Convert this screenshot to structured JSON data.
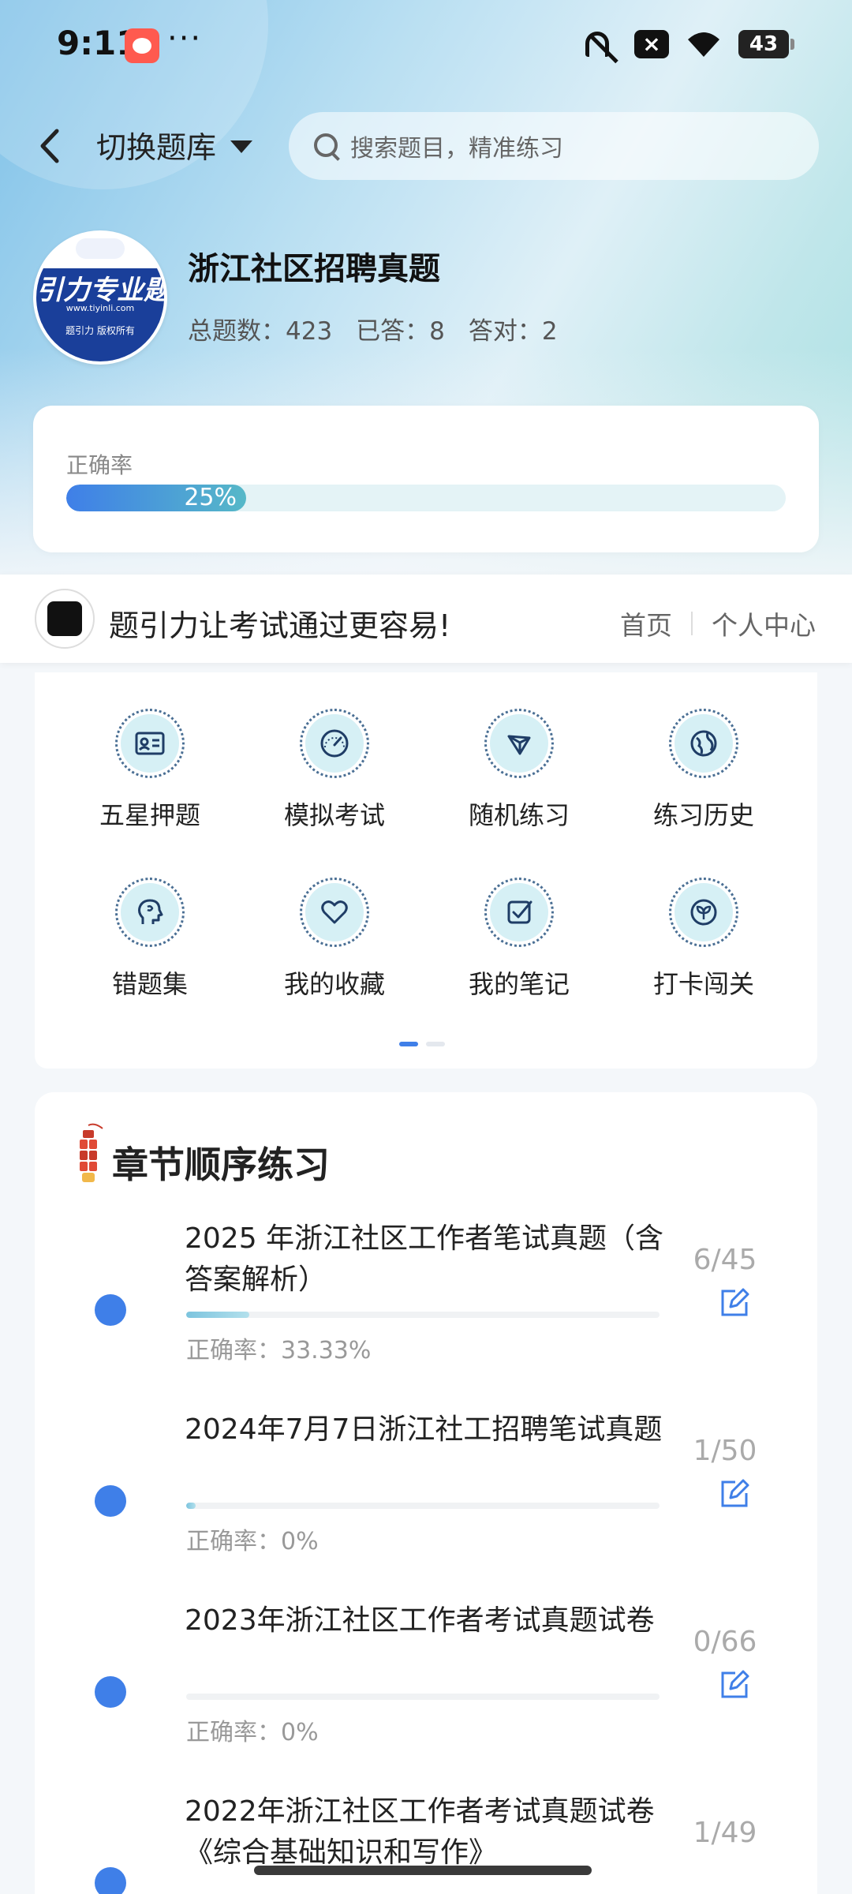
{
  "status_bar": {
    "time": "9:11",
    "more": "···",
    "battery": "43"
  },
  "header": {
    "switch_label": "切换题库",
    "search_placeholder": "搜索题目，精准练习"
  },
  "bank": {
    "title": "浙江社区招聘真题",
    "logo_text": "引力专业题",
    "logo_url": "www.tiyinli.com",
    "logo_footer": "题引力 版权所有",
    "stats": {
      "total_label": "总题数：",
      "total": "423",
      "answered_label": "已答：",
      "answered": "8",
      "correct_label": "答对：",
      "correct": "2"
    }
  },
  "accuracy": {
    "label": "正确率",
    "value_text": "25%",
    "fraction": 0.25
  },
  "banner": {
    "slogan": "题引力让考试通过更容易!",
    "home_link": "首页",
    "profile_link": "个人中心"
  },
  "menu": {
    "items": [
      {
        "label": "五星押题",
        "icon": "id-card-icon"
      },
      {
        "label": "模拟考试",
        "icon": "gauge-icon"
      },
      {
        "label": "随机练习",
        "icon": "network-icon"
      },
      {
        "label": "练习历史",
        "icon": "globe-icon"
      },
      {
        "label": "错题集",
        "icon": "head-icon"
      },
      {
        "label": "我的收藏",
        "icon": "heart-icon"
      },
      {
        "label": "我的笔记",
        "icon": "checkbox-icon"
      },
      {
        "label": "打卡闯关",
        "icon": "leaf-icon"
      }
    ]
  },
  "chapters": {
    "title": "章节顺序练习",
    "items": [
      {
        "name": "2025 年浙江社区工作者笔试真题（含答案解析）",
        "count": "6/45",
        "accuracy": "正确率：33.33%",
        "progress": 0.133
      },
      {
        "name": "2024年7月7日浙江社工招聘笔试真题",
        "count": "1/50",
        "accuracy": "正确率：0%",
        "progress": 0.02
      },
      {
        "name": "2023年浙江社区工作者考试真题试卷",
        "count": "0/66",
        "accuracy": "正确率：0%",
        "progress": 0
      },
      {
        "name": "2022年浙江社区工作者考试真题试卷《综合基础知识和写作》",
        "count": "1/49",
        "accuracy": "",
        "progress": 0.02
      }
    ]
  },
  "colors": {
    "accent": "#3f7fe8",
    "teal": "#56b8c8",
    "logo_blue": "#1a3f9a"
  }
}
